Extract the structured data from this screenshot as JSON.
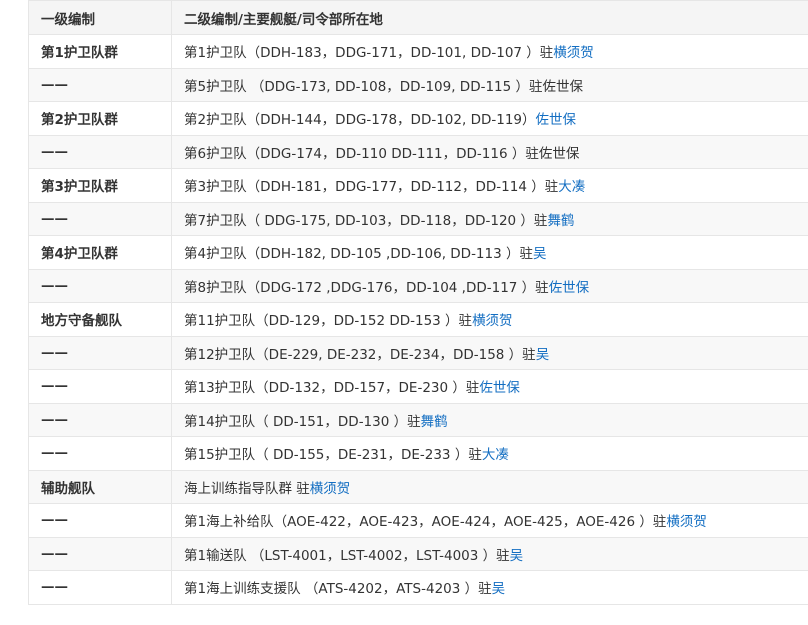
{
  "table": {
    "headers": [
      "一级编制",
      "二级编制/主要舰艇/司令部所在地"
    ],
    "rows": [
      {
        "unit": "第1护卫队群",
        "text": "第1护卫队（DDH-183，DDG-171，DD-101, DD-107 ）驻",
        "link": "横须贺"
      },
      {
        "unit": "——",
        "text": "第5护卫队 （DDG-173, DD-108，DD-109, DD-115 ）驻佐世保",
        "link": ""
      },
      {
        "unit": "第2护卫队群",
        "text": "第2护卫队（DDH-144，DDG-178，DD-102, DD-119）",
        "link": "佐世保"
      },
      {
        "unit": "——",
        "text": "第6护卫队（DDG-174，DD-110 DD-111，DD-116 ）驻佐世保",
        "link": ""
      },
      {
        "unit": "第3护卫队群",
        "text": "第3护卫队（DDH-181，DDG-177，DD-112，DD-114 ）驻",
        "link": "大凑"
      },
      {
        "unit": "——",
        "text": "第7护卫队（ DDG-175, DD-103，DD-118，DD-120 ）驻",
        "link": "舞鹤"
      },
      {
        "unit": "第4护卫队群",
        "text": "第4护卫队（DDH-182, DD-105 ,DD-106, DD-113 ）驻",
        "link": "吴"
      },
      {
        "unit": "——",
        "text": "第8护卫队（DDG-172 ,DDG-176，DD-104 ,DD-117 ）驻",
        "link": "佐世保"
      },
      {
        "unit": "地方守备舰队",
        "text": "第11护卫队（DD-129，DD-152 DD-153 ）驻",
        "link": "横须贺"
      },
      {
        "unit": "——",
        "text": "第12护卫队（DE-229, DE-232，DE-234，DD-158 ）驻",
        "link": "吴"
      },
      {
        "unit": "——",
        "text": "第13护卫队（DD-132，DD-157，DE-230 ）驻",
        "link": "佐世保"
      },
      {
        "unit": "——",
        "text": "第14护卫队（ DD-151，DD-130 ）驻",
        "link": "舞鹤"
      },
      {
        "unit": "——",
        "text": "第15护卫队（ DD-155，DE-231，DE-233 ）驻",
        "link": "大凑"
      },
      {
        "unit": "辅助舰队",
        "text": "海上训练指导队群 驻",
        "link": "横须贺"
      },
      {
        "unit": "——",
        "text": "第1海上补给队（AOE-422，AOE-423，AOE-424，AOE-425，AOE-426 ）驻",
        "link": "横须贺"
      },
      {
        "unit": "——",
        "text": "第1输送队 （LST-4001，LST-4002，LST-4003 ）驻",
        "link": "吴"
      },
      {
        "unit": "——",
        "text": "第1海上训练支援队 （ATS-4202，ATS-4203 ）驻",
        "link": "吴"
      }
    ]
  }
}
